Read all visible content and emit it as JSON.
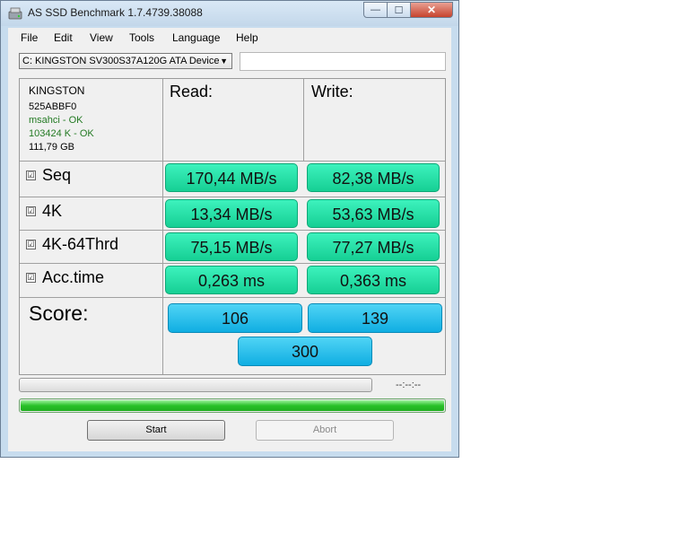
{
  "window": {
    "title": "AS SSD Benchmark 1.7.4739.38088",
    "min_glyph": "—",
    "max_glyph": "☐",
    "close_glyph": "✕"
  },
  "menu": [
    "File",
    "Edit",
    "View",
    "Tools",
    "Language",
    "Help"
  ],
  "drive": {
    "selected": "C: KINGSTON SV300S37A120G ATA Device",
    "arrow": "▼"
  },
  "info": {
    "model": "KINGSTON",
    "firmware": "525ABBF0",
    "driver": "msahci - OK",
    "alignment": "103424 K - OK",
    "size": "111,79 GB"
  },
  "headers": {
    "read": "Read:",
    "write": "Write:"
  },
  "tests": [
    {
      "label": "Seq",
      "checked": "☑",
      "read": "170,44 MB/s",
      "write": "82,38 MB/s"
    },
    {
      "label": "4K",
      "checked": "☑",
      "read": "13,34 MB/s",
      "write": "53,63 MB/s"
    },
    {
      "label": "4K-64Thrd",
      "checked": "☑",
      "read": "75,15 MB/s",
      "write": "77,27 MB/s"
    },
    {
      "label": "Acc.time",
      "checked": "☑",
      "read": "0,263 ms",
      "write": "0,363 ms"
    }
  ],
  "score": {
    "label": "Score:",
    "read": "106",
    "write": "139",
    "total": "300"
  },
  "status": {
    "time": "--:--:--",
    "progress_fraction": 1.0
  },
  "buttons": {
    "start": "Start",
    "abort": "Abort"
  },
  "colors": {
    "result_green": "#22dca2",
    "score_blue": "#23bdea",
    "progress_green": "#29c129"
  }
}
